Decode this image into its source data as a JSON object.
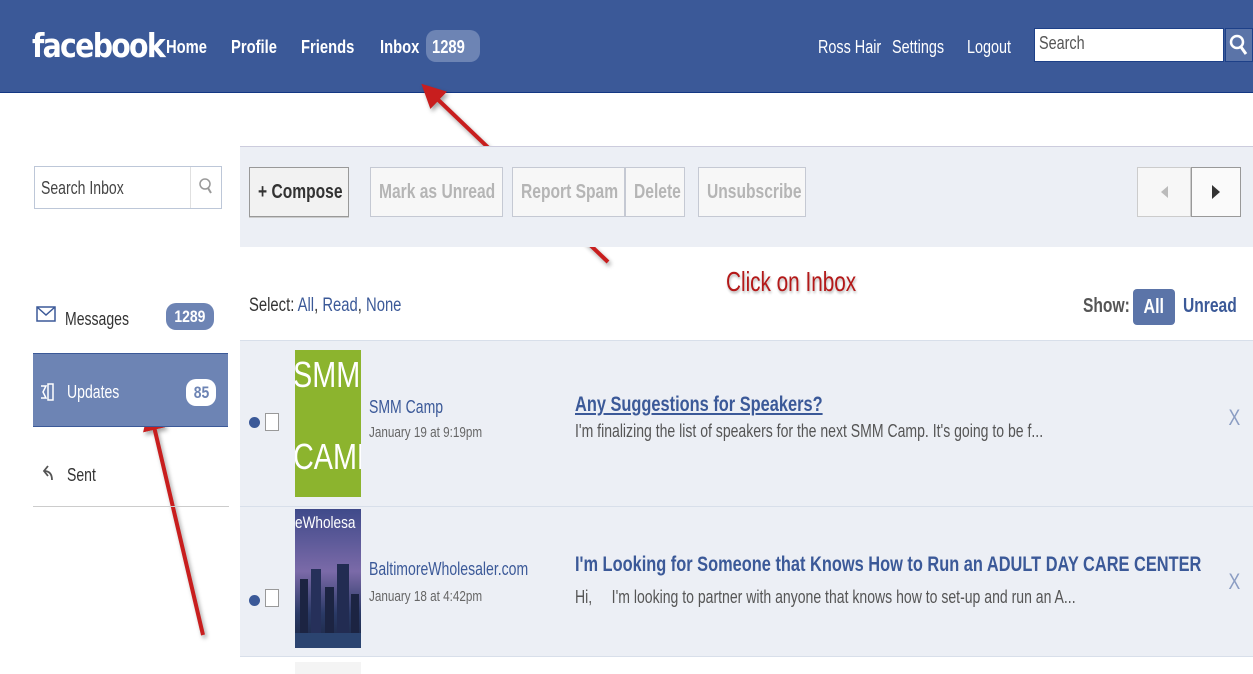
{
  "header": {
    "logo": "facebook",
    "nav": [
      "Home",
      "Profile",
      "Friends",
      "Inbox"
    ],
    "inbox_count": "1289",
    "user_name": "Ross Hair",
    "settings": "Settings",
    "logout": "Logout",
    "search_placeholder": "Search"
  },
  "sidebar": {
    "search_placeholder": "Search Inbox",
    "items": [
      {
        "label": "Messages",
        "count": "1289",
        "icon": "envelope-icon"
      },
      {
        "label": "Updates",
        "count": "85",
        "icon": "updates-icon",
        "selected": true
      },
      {
        "label": "Sent",
        "icon": "sent-arrow-icon"
      }
    ]
  },
  "toolbar": {
    "compose": "+ Compose",
    "mark_unread": "Mark as Unread",
    "report_spam": "Report Spam",
    "delete": "Delete",
    "unsubscribe": "Unsubscribe"
  },
  "filter": {
    "select_label": "Select:",
    "all": "All",
    "read": "Read",
    "none": "None",
    "show_label": "Show:",
    "show_all": "All",
    "show_unread": "Unread"
  },
  "annotation": {
    "text": "Click on Inbox",
    "color": "#b41919"
  },
  "messages": [
    {
      "sender": "SMM Camp",
      "date": "January 19 at 9:19pm",
      "subject": "Any Suggestions for Speakers?",
      "preview": "I'm finalizing the list of speakers for the next SMM Camp. It's going to be f...",
      "thumb_text": [
        "SMM",
        "CAMP"
      ],
      "unread": true
    },
    {
      "sender": "BaltimoreWholesaler.com",
      "date": "January 18 at 4:42pm",
      "subject": "I'm Looking for Someone that Knows How to Run an ADULT DAY CARE CENTER",
      "preview": "Hi,     I'm looking to partner with anyone that knows how to set-up and run an A...",
      "thumb_text": [
        "eWholesa"
      ],
      "unread": true
    }
  ],
  "colors": {
    "brand": "#3b5998",
    "badge": "#6d84b4",
    "row_bg": "#eceff5",
    "smm_green": "#8cb42e"
  }
}
